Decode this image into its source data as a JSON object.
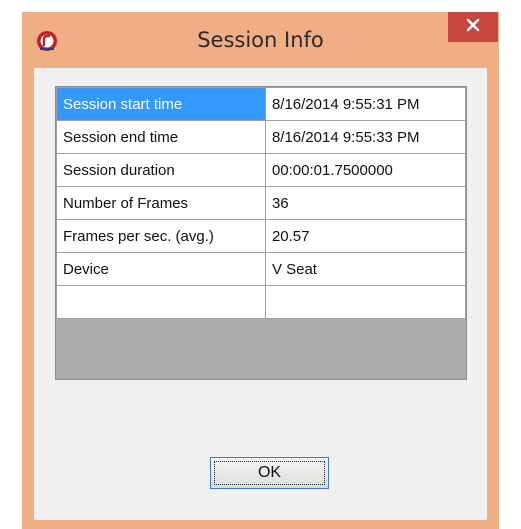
{
  "window": {
    "title": "Session Info",
    "close_glyph": "✕",
    "icons": {
      "app": "app-logo-icon",
      "close": "close-icon"
    },
    "colors": {
      "frame": "#f0ae85",
      "close_button": "#c7463e",
      "selection": "#3399ff"
    }
  },
  "session": {
    "rows": [
      {
        "key": "Session start time",
        "value": "8/16/2014 9:55:31 PM",
        "selected": true
      },
      {
        "key": "Session end time",
        "value": "8/16/2014 9:55:33 PM"
      },
      {
        "key": "Session duration",
        "value": "00:00:01.7500000"
      },
      {
        "key": "Number of Frames",
        "value": "36"
      },
      {
        "key": "Frames per sec. (avg.)",
        "value": "20.57"
      },
      {
        "key": "Device",
        "value": "V Seat"
      },
      {
        "key": "",
        "value": ""
      }
    ]
  },
  "buttons": {
    "ok_label": "OK"
  }
}
